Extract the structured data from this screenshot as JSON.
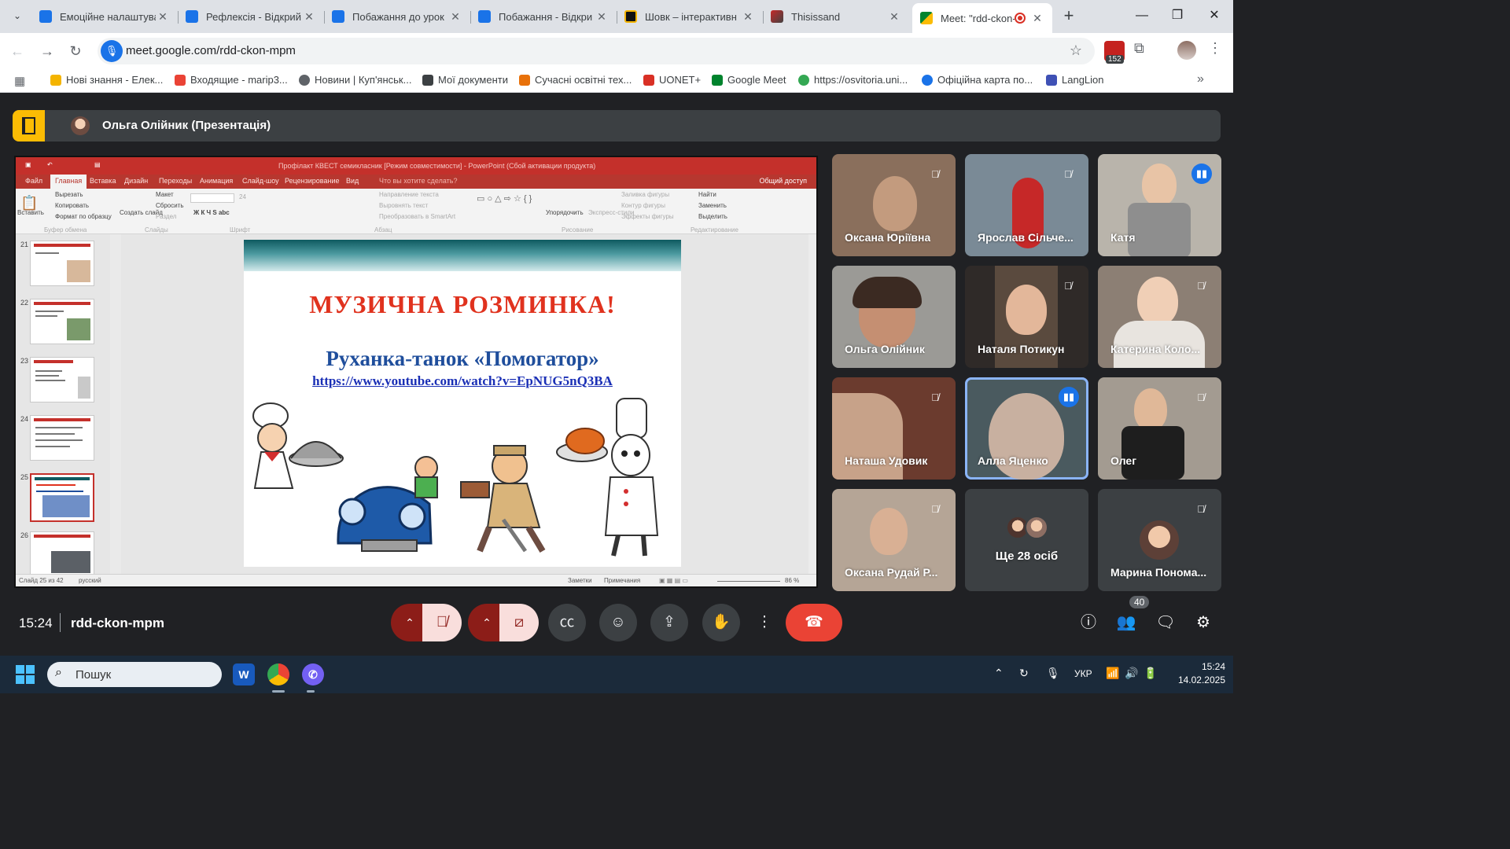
{
  "browser": {
    "tabs": [
      {
        "title": "Емоційне налаштува",
        "color": "#1a73e8"
      },
      {
        "title": "Рефлексія - Відкрий",
        "color": "#1a73e8"
      },
      {
        "title": "Побажання до урок",
        "color": "#1a73e8"
      },
      {
        "title": "Побажання - Відкри",
        "color": "#1a73e8"
      },
      {
        "title": "Шовк – інтерактивн",
        "color": "#111111"
      },
      {
        "title": "Thisissand",
        "color": "#555555"
      },
      {
        "title": "Meet: \"rdd-ckon-",
        "color": "#00832d",
        "active": true
      }
    ],
    "url": "meet.google.com/rdd-ckon-mpm",
    "extension_badge": "152",
    "bookmarks": [
      {
        "label": "Нові знання - Елек...",
        "color": "#f4b400"
      },
      {
        "label": "Входящие - marip3...",
        "color": "#ea4335"
      },
      {
        "label": "Новини | Куп'янськ...",
        "color": "#5f6368"
      },
      {
        "label": "Мої документи",
        "color": "#3c4043"
      },
      {
        "label": "Сучасні освітні тех...",
        "color": "#e8710a"
      },
      {
        "label": "UONET+",
        "color": "#d93025"
      },
      {
        "label": "Google Meet",
        "color": "#00832d"
      },
      {
        "label": "https://osvitoria.uni...",
        "color": "#34a853"
      },
      {
        "label": "Офіційна карта по...",
        "color": "#1a73e8"
      },
      {
        "label": "LangLion",
        "color": "#3f51b5"
      }
    ]
  },
  "meet": {
    "presenter": "Ольга Олійник (Презентація)",
    "time": "15:24",
    "meeting_code": "rdd-ckon-mpm",
    "people_count": "40",
    "participants": [
      {
        "name": "Оксана Юріївна",
        "muted": true,
        "bg": "#8a6f5c"
      },
      {
        "name": "Ярослав Сільче...",
        "muted": true,
        "bg": "#7a8a96"
      },
      {
        "name": "Катя",
        "muted": false,
        "speaking_icon": true,
        "bg": "#b9b4ab"
      },
      {
        "name": "Ольга Олійник",
        "muted": false,
        "bg": "#9b9a96"
      },
      {
        "name": "Наталя Потикун",
        "muted": true,
        "bg": "#5a4a3e"
      },
      {
        "name": "Катерина Коло...",
        "muted": true,
        "bg": "#8c7f74"
      },
      {
        "name": "Наташа Удовик",
        "muted": true,
        "bg": "#6b3b2e"
      },
      {
        "name": "Алла Яценко",
        "muted": false,
        "speaking_icon": true,
        "active": true,
        "bg": "#4a5a5f"
      },
      {
        "name": "Олег",
        "muted": true,
        "bg": "#a39b91"
      },
      {
        "name": "Оксана Рудай Р...",
        "muted": true,
        "bg": "#b5a596"
      },
      {
        "name": "Ще 28 осіб",
        "muted": false,
        "bg": "#3c4043"
      },
      {
        "name": "Марина Пономa...",
        "muted": true,
        "bg": "#3c4043"
      }
    ]
  },
  "powerpoint": {
    "title_bar": "Профілакт КВЕСТ семикласник [Режим совместимости] - PowerPoint (Сбой активации продукта)",
    "tabs": [
      "Файл",
      "Главная",
      "Вставка",
      "Дизайн",
      "Переходы",
      "Анимация",
      "Слайд-шоу",
      "Рецензирование",
      "Вид"
    ],
    "tell_me": "Что вы хотите сделать?",
    "share": "Общий доступ",
    "ribbon": {
      "paste": "Вставить",
      "cut": "Вырезать",
      "copy": "Копировать",
      "format_painter": "Формат по образцу",
      "new_slide": "Создать слайд",
      "layout": "Макет",
      "reset": "Сбросить",
      "section": "Раздел",
      "font_size": "24",
      "find": "Найти",
      "replace": "Заменить",
      "select": "Выделить",
      "arrange": "Упорядочить",
      "quick_styles": "Экспресс-стили",
      "shape_fill": "Заливка фигуры",
      "shape_outline": "Контур фигуры",
      "shape_effects": "Эффекты фигуры",
      "text_direction": "Направление текста",
      "align_text": "Выровнять текст",
      "smartart": "Преобразовать в SmartArt",
      "groups": [
        "Буфер обмена",
        "Слайды",
        "Шрифт",
        "Абзац",
        "Рисование",
        "Редактирование"
      ]
    },
    "thumb_numbers": [
      "21",
      "22",
      "23",
      "24",
      "25",
      "26"
    ],
    "status": {
      "slide_of": "Слайд 25 из 42",
      "language": "русский",
      "notes": "Заметки",
      "comments": "Примечания",
      "zoom": "86 %"
    },
    "slide": {
      "title": "МУЗИЧНА   РОЗМИНКА!",
      "subtitle": "Руханка-танок «Помогатор»",
      "link": "https://www.youtube.com/watch?v=EpNUG5nQ3BA"
    }
  },
  "taskbar": {
    "search_placeholder": "Пошук",
    "language": "УКР",
    "time": "15:24",
    "date": "14.02.2025"
  }
}
